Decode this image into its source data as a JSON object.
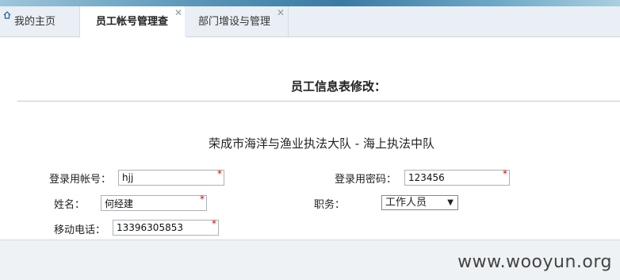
{
  "tabs": [
    {
      "label": "我的主页"
    },
    {
      "label": "员工帐号管理查"
    },
    {
      "label": "部门增设与管理"
    }
  ],
  "form": {
    "title": "员工信息表修改：",
    "org": "荣成市海洋与渔业执法大队 - 海上执法中队",
    "login_account_label": "登录用帐号：",
    "login_account_value": "hjj",
    "login_password_label": "登录用密码：",
    "login_password_value": "123456",
    "name_label": "姓名：",
    "name_value": "何经建",
    "position_label": "职务：",
    "position_value": "工作人员",
    "phone_label": "移动电话：",
    "phone_value": "13396305853",
    "required_mark": "*"
  },
  "watermark": "www.wooyun.org"
}
